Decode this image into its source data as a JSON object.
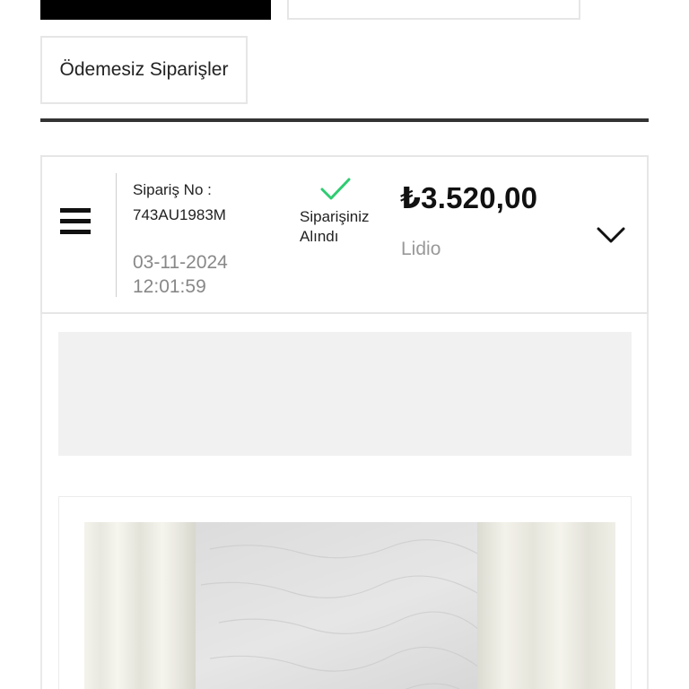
{
  "tabs": {
    "black_tab_label": "",
    "outline_tab_label": ""
  },
  "filter": {
    "unpaid_orders_label": "Ödemesiz Siparişler"
  },
  "order": {
    "label": "Sipariş No :",
    "number": "743AU1983M",
    "date": "03-11-2024",
    "time": "12:01:59",
    "status_line1": "Siparişiniz",
    "status_line2": "Alındı",
    "price": "₺3.520,00",
    "payment_provider": "Lidio"
  },
  "icons": {
    "menu": "hamburger-menu-icon",
    "status": "checkmark-icon",
    "expand": "chevron-down-icon"
  },
  "colors": {
    "status_check": "#2ecc71",
    "primary_text": "#222222",
    "muted_text": "#888888",
    "border": "#e6e6e6",
    "divider": "#333333"
  }
}
